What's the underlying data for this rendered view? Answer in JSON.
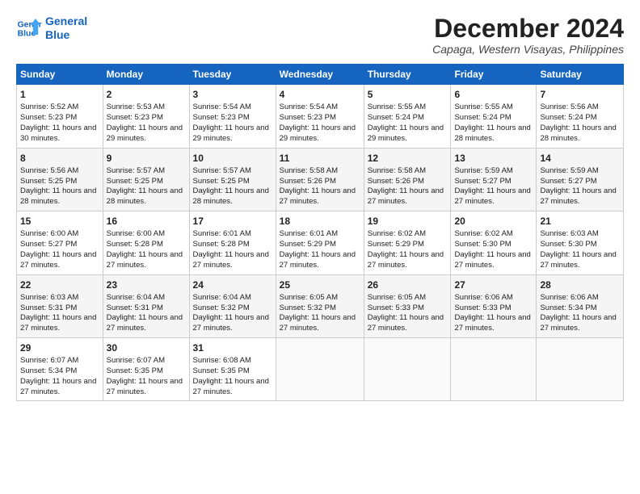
{
  "logo": {
    "line1": "General",
    "line2": "Blue"
  },
  "title": "December 2024",
  "location": "Capaga, Western Visayas, Philippines",
  "days_of_week": [
    "Sunday",
    "Monday",
    "Tuesday",
    "Wednesday",
    "Thursday",
    "Friday",
    "Saturday"
  ],
  "weeks": [
    [
      {
        "day": "1",
        "sunrise": "5:52 AM",
        "sunset": "5:23 PM",
        "daylight": "11 hours and 30 minutes."
      },
      {
        "day": "2",
        "sunrise": "5:53 AM",
        "sunset": "5:23 PM",
        "daylight": "11 hours and 29 minutes."
      },
      {
        "day": "3",
        "sunrise": "5:54 AM",
        "sunset": "5:23 PM",
        "daylight": "11 hours and 29 minutes."
      },
      {
        "day": "4",
        "sunrise": "5:54 AM",
        "sunset": "5:23 PM",
        "daylight": "11 hours and 29 minutes."
      },
      {
        "day": "5",
        "sunrise": "5:55 AM",
        "sunset": "5:24 PM",
        "daylight": "11 hours and 29 minutes."
      },
      {
        "day": "6",
        "sunrise": "5:55 AM",
        "sunset": "5:24 PM",
        "daylight": "11 hours and 28 minutes."
      },
      {
        "day": "7",
        "sunrise": "5:56 AM",
        "sunset": "5:24 PM",
        "daylight": "11 hours and 28 minutes."
      }
    ],
    [
      {
        "day": "8",
        "sunrise": "5:56 AM",
        "sunset": "5:25 PM",
        "daylight": "11 hours and 28 minutes."
      },
      {
        "day": "9",
        "sunrise": "5:57 AM",
        "sunset": "5:25 PM",
        "daylight": "11 hours and 28 minutes."
      },
      {
        "day": "10",
        "sunrise": "5:57 AM",
        "sunset": "5:25 PM",
        "daylight": "11 hours and 28 minutes."
      },
      {
        "day": "11",
        "sunrise": "5:58 AM",
        "sunset": "5:26 PM",
        "daylight": "11 hours and 27 minutes."
      },
      {
        "day": "12",
        "sunrise": "5:58 AM",
        "sunset": "5:26 PM",
        "daylight": "11 hours and 27 minutes."
      },
      {
        "day": "13",
        "sunrise": "5:59 AM",
        "sunset": "5:27 PM",
        "daylight": "11 hours and 27 minutes."
      },
      {
        "day": "14",
        "sunrise": "5:59 AM",
        "sunset": "5:27 PM",
        "daylight": "11 hours and 27 minutes."
      }
    ],
    [
      {
        "day": "15",
        "sunrise": "6:00 AM",
        "sunset": "5:27 PM",
        "daylight": "11 hours and 27 minutes."
      },
      {
        "day": "16",
        "sunrise": "6:00 AM",
        "sunset": "5:28 PM",
        "daylight": "11 hours and 27 minutes."
      },
      {
        "day": "17",
        "sunrise": "6:01 AM",
        "sunset": "5:28 PM",
        "daylight": "11 hours and 27 minutes."
      },
      {
        "day": "18",
        "sunrise": "6:01 AM",
        "sunset": "5:29 PM",
        "daylight": "11 hours and 27 minutes."
      },
      {
        "day": "19",
        "sunrise": "6:02 AM",
        "sunset": "5:29 PM",
        "daylight": "11 hours and 27 minutes."
      },
      {
        "day": "20",
        "sunrise": "6:02 AM",
        "sunset": "5:30 PM",
        "daylight": "11 hours and 27 minutes."
      },
      {
        "day": "21",
        "sunrise": "6:03 AM",
        "sunset": "5:30 PM",
        "daylight": "11 hours and 27 minutes."
      }
    ],
    [
      {
        "day": "22",
        "sunrise": "6:03 AM",
        "sunset": "5:31 PM",
        "daylight": "11 hours and 27 minutes."
      },
      {
        "day": "23",
        "sunrise": "6:04 AM",
        "sunset": "5:31 PM",
        "daylight": "11 hours and 27 minutes."
      },
      {
        "day": "24",
        "sunrise": "6:04 AM",
        "sunset": "5:32 PM",
        "daylight": "11 hours and 27 minutes."
      },
      {
        "day": "25",
        "sunrise": "6:05 AM",
        "sunset": "5:32 PM",
        "daylight": "11 hours and 27 minutes."
      },
      {
        "day": "26",
        "sunrise": "6:05 AM",
        "sunset": "5:33 PM",
        "daylight": "11 hours and 27 minutes."
      },
      {
        "day": "27",
        "sunrise": "6:06 AM",
        "sunset": "5:33 PM",
        "daylight": "11 hours and 27 minutes."
      },
      {
        "day": "28",
        "sunrise": "6:06 AM",
        "sunset": "5:34 PM",
        "daylight": "11 hours and 27 minutes."
      }
    ],
    [
      {
        "day": "29",
        "sunrise": "6:07 AM",
        "sunset": "5:34 PM",
        "daylight": "11 hours and 27 minutes."
      },
      {
        "day": "30",
        "sunrise": "6:07 AM",
        "sunset": "5:35 PM",
        "daylight": "11 hours and 27 minutes."
      },
      {
        "day": "31",
        "sunrise": "6:08 AM",
        "sunset": "5:35 PM",
        "daylight": "11 hours and 27 minutes."
      },
      null,
      null,
      null,
      null
    ]
  ]
}
